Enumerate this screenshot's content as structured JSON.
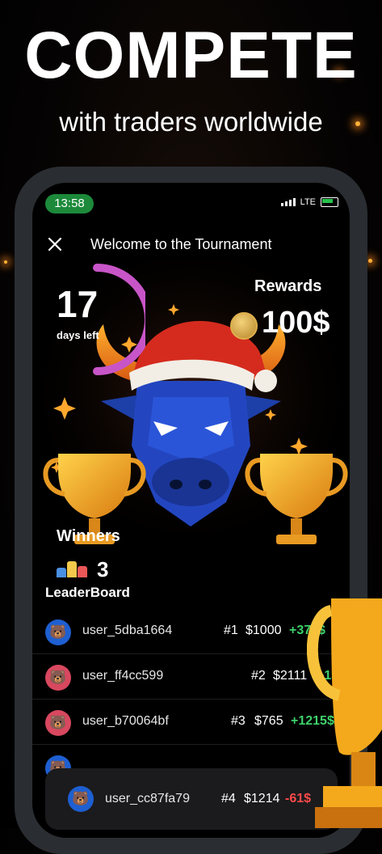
{
  "headline": "COMPETE",
  "subheadline": "with traders worldwide",
  "status_bar": {
    "time": "13:58",
    "network": "LTE"
  },
  "header": {
    "title": "Welcome to the Tournament",
    "close_icon": "close-icon"
  },
  "countdown": {
    "days": "17",
    "label": "days left",
    "progress_fraction": 0.55,
    "color": "#c855c8"
  },
  "rewards": {
    "label": "Rewards",
    "amount": "100$",
    "icon": "coin-icon"
  },
  "winners": {
    "label": "Winners",
    "count": "3",
    "icon": "podium-icon"
  },
  "leaderboard": {
    "title": "LeaderBoard",
    "rows": [
      {
        "username": "user_5dba1664",
        "rank": "#1",
        "amount": "$1000",
        "change": "+372$",
        "avatar_bg": "#1e5fd1",
        "positive": true
      },
      {
        "username": "user_ff4cc599",
        "rank": "#2",
        "amount": "$2111",
        "change": "+1$",
        "avatar_bg": "#d8485f",
        "positive": true
      },
      {
        "username": "user_b70064bf",
        "rank": "#3",
        "amount": "$765",
        "change": "+1215$",
        "avatar_bg": "#d8485f",
        "positive": true
      }
    ],
    "current_user": {
      "username": "user_cc87fa79",
      "rank": "#4",
      "amount": "$1214",
      "change": "-61$",
      "avatar_bg": "#1e5fd1",
      "positive": false
    }
  },
  "colors": {
    "positive": "#3ed06a",
    "negative": "#ff4a4a",
    "accent": "#c855c8",
    "status_pill": "#1c8a3a"
  }
}
